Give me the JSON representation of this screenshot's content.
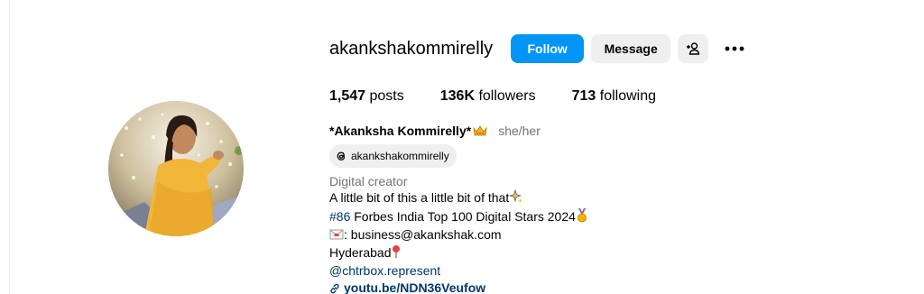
{
  "profile": {
    "username": "akankshakommirelly",
    "follow_label": "Follow",
    "message_label": "Message",
    "stats": {
      "posts_count": "1,547",
      "posts_label": "posts",
      "followers_count": "136K",
      "followers_label": "followers",
      "following_count": "713",
      "following_label": "following"
    },
    "full_name": "*Akanksha Kommirelly*",
    "name_emoji": "crown-icon",
    "pronouns": "she/her",
    "threads_handle": "akankshakommirelly",
    "category": "Digital creator",
    "bio_lines": {
      "line1": "A little bit of this a little bit of that",
      "line2_tag": "#86",
      "line2_text": " Forbes India Top 100 Digital Stars 2024",
      "line3_text": ": business@akankshak.com",
      "line4_text": "Hyderabad",
      "mention": "@chtrbox.represent",
      "website": "youtu.be/NDN36Veufow"
    }
  },
  "colors": {
    "accent_blue": "#0095f6",
    "link_blue": "#00376b",
    "secondary_text": "#737373",
    "button_gray": "#efefef"
  },
  "icons": {
    "add_user": "person-plus-icon",
    "more": "more-horizontal-icon",
    "threads": "threads-icon",
    "sparkle": "sparkles-icon",
    "medal": "medal-icon",
    "envelope": "envelope-icon",
    "pin": "round-pushpin-icon",
    "link": "link-icon"
  }
}
